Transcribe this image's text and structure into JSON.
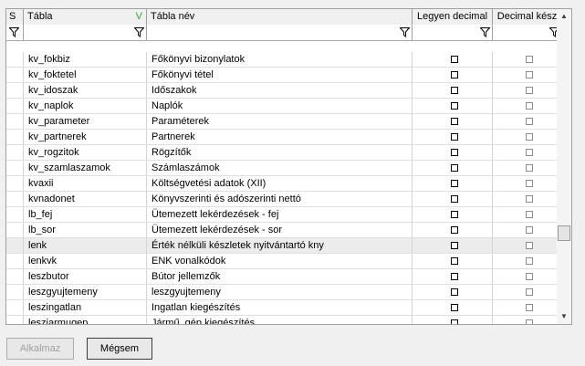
{
  "columns": {
    "s": "S",
    "tabla": "Tábla",
    "tabla_check": "V",
    "tabla_nev": "Tábla név",
    "legyen_decimal": "Legyen decimal",
    "decimal_kesz": "Decimal kész"
  },
  "rows": [
    {
      "tabla": "kv_fokbiz",
      "nev": "Főkönyvi bizonylatok"
    },
    {
      "tabla": "kv_foktetel",
      "nev": "Főkönyvi tétel"
    },
    {
      "tabla": "kv_idoszak",
      "nev": "Időszakok"
    },
    {
      "tabla": "kv_naplok",
      "nev": "Naplók"
    },
    {
      "tabla": "kv_parameter",
      "nev": "Paraméterek"
    },
    {
      "tabla": "kv_partnerek",
      "nev": "Partnerek"
    },
    {
      "tabla": "kv_rogzitok",
      "nev": "Rögzítők"
    },
    {
      "tabla": "kv_szamlaszamok",
      "nev": "Számlaszámok"
    },
    {
      "tabla": "kvaxii",
      "nev": "Költségvetési adatok (XII)"
    },
    {
      "tabla": "kvnadonet",
      "nev": "Könyvszerinti és adószerinti nettó"
    },
    {
      "tabla": "lb_fej",
      "nev": "Ütemezett lekérdezések - fej"
    },
    {
      "tabla": "lb_sor",
      "nev": "Ütemezett lekérdezések - sor"
    },
    {
      "tabla": "lenk",
      "nev": "Érték nélküli készletek nyitvántartó kny"
    },
    {
      "tabla": "lenkvk",
      "nev": "ENK vonalkódok"
    },
    {
      "tabla": "leszbutor",
      "nev": "Bútor jellemzők"
    },
    {
      "tabla": "leszgyujtemeny",
      "nev": "leszgyujtemeny"
    },
    {
      "tabla": "leszingatlan",
      "nev": "Ingatlan kiegészítés"
    },
    {
      "tabla": "leszjarmugep",
      "nev": "Jármű, gép kiegészítés"
    }
  ],
  "buttons": {
    "apply": "Alkalmaz",
    "cancel": "Mégsem"
  },
  "colors": {
    "check_mark": "#2eaa2e",
    "highlight_row": "#ececec"
  }
}
